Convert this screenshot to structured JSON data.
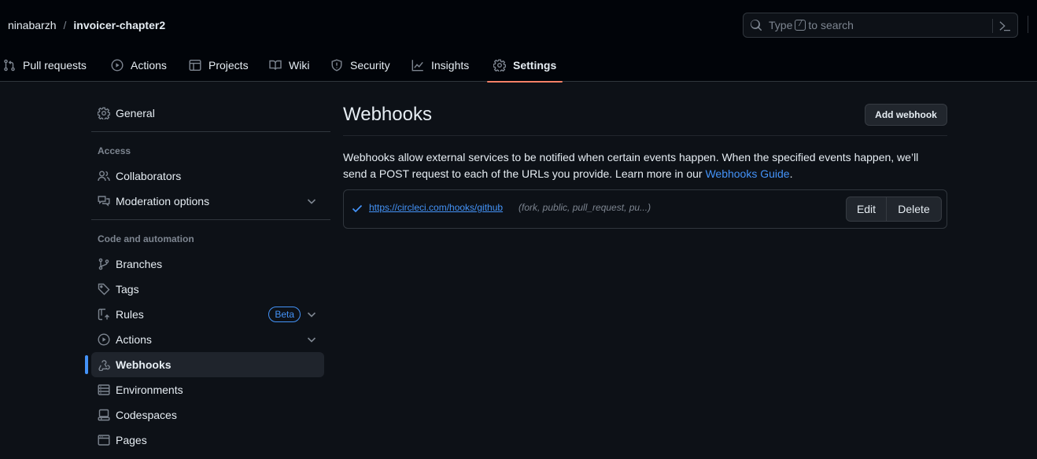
{
  "header": {
    "owner": "ninabarzh",
    "separator": "/",
    "repo": "invoicer-chapter2",
    "search": {
      "prefix": "Type",
      "key": "/",
      "suffix": "to search"
    }
  },
  "tabs": [
    {
      "label": "Pull requests",
      "icon": "git-pull-request-icon"
    },
    {
      "label": "Actions",
      "icon": "play-icon"
    },
    {
      "label": "Projects",
      "icon": "table-icon"
    },
    {
      "label": "Wiki",
      "icon": "book-icon"
    },
    {
      "label": "Security",
      "icon": "shield-icon"
    },
    {
      "label": "Insights",
      "icon": "graph-icon"
    },
    {
      "label": "Settings",
      "icon": "gear-icon",
      "active": true
    }
  ],
  "sidebar": {
    "general": "General",
    "access_heading": "Access",
    "collaborators": "Collaborators",
    "moderation": "Moderation options",
    "code_heading": "Code and automation",
    "branches": "Branches",
    "tags": "Tags",
    "rules": "Rules",
    "rules_badge": "Beta",
    "actions": "Actions",
    "webhooks": "Webhooks",
    "environments": "Environments",
    "codespaces": "Codespaces",
    "pages": "Pages"
  },
  "main": {
    "title": "Webhooks",
    "add_button": "Add webhook",
    "description": "Webhooks allow external services to be notified when certain events happen. When the specified events happen, we’ll send a POST request to each of the URLs you provide. Learn more in our",
    "guide_link": "Webhooks Guide",
    "period": ".",
    "webhooks": [
      {
        "url": "https://circleci.com/hooks/github",
        "events": "(fork, public, pull_request, pu...)",
        "edit": "Edit",
        "delete": "Delete"
      }
    ]
  },
  "colors": {
    "background": "#0d1117",
    "header": "#010409",
    "accent": "#4493f8",
    "tab_underline": "#f78166",
    "success": "#3fb950"
  }
}
